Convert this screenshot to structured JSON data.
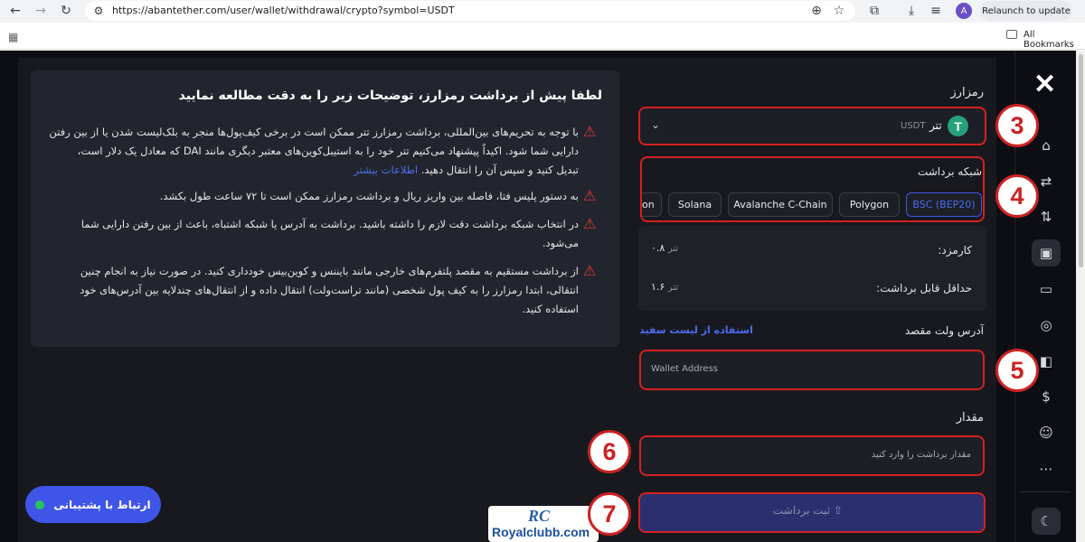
{
  "browser": {
    "url": "https://abantether.com/user/wallet/withdrawal/crypto?symbol=USDT",
    "avatar_letter": "A",
    "relaunch_label": "Relaunch to update",
    "all_bookmarks": "All Bookmarks"
  },
  "notice": {
    "title": "لطفا پیش از برداشت رمزارز، توضیحات زیر را به دقت مطالعه نمایید",
    "items": [
      {
        "lines": [
          "با توجه به تحریم‌های بین‌المللی، برداشت رمزارز تتر ممکن است در برخی کیف‌پول‌ها منجر به بلک‌لیست شدن یا از بین رفتن",
          "دارایی شما شود. اکیداً پیشنهاد می‌کنیم تتر خود را به استیبل‌کوین‌های معتبر دیگری مانند DAI که معادل یک دلار است،",
          "تبدیل کنید و سپس آن را انتقال دهید."
        ],
        "link": "اطلاعات بیشتر"
      },
      {
        "lines": [
          "به دستور پلیس فتا، فاصله بین واریز ریال و برداشت رمزارز ممکن است تا ۷۲ ساعت طول بکشد."
        ]
      },
      {
        "lines": [
          "در انتخاب شبکه برداشت دقت لازم را داشته باشید. برداشت به آدرس یا شبکه اشتباه، باعث از بین رفتن دارایی شما",
          "می‌شود."
        ]
      },
      {
        "lines": [
          "از برداشت مستقیم به مقصد پلتفرم‌های خارجی مانند بایننس و کوین‌بیس خودداری کنید. در صورت نیاز به انجام چنین",
          "انتقالی، ابتدا رمزارز را به کیف پول شخصی (مانند تراست‌ولت) انتقال داده و از انتقال‌های چندلایه بین آدرس‌های خود",
          "استفاده کنید."
        ]
      }
    ]
  },
  "form": {
    "currency_label": "رمزارز",
    "currency_name": "تتر",
    "currency_symbol": "USDT",
    "network_label": "شبکه برداشت",
    "networks": [
      "BSC (BEP20)",
      "Polygon",
      "Avalanche C-Chain",
      "Solana",
      "on"
    ],
    "fee_label": "کارمزد:",
    "fee_value": "۰.۸",
    "fee_unit": "تتر",
    "min_label": "حداقل قابل برداشت:",
    "min_value": "۱.۶",
    "min_unit": "تتر",
    "address_label": "آدرس ولت مقصد",
    "whitelist_link": "استفاده از لیست سفید",
    "address_placeholder": "Wallet Address",
    "amount_label": "مقدار",
    "amount_placeholder": "مقدار برداشت را وارد کنید",
    "submit_label": "ثبت برداشت"
  },
  "support_button": "ارتباط با پشتیبانی",
  "watermark": "Royalclubb.com",
  "watermark_logo": "RC",
  "markers": [
    "3",
    "4",
    "5",
    "6",
    "7"
  ],
  "colors": {
    "accent_red": "#d62020",
    "link_blue": "#4e6cf0",
    "support_blue": "#3f55e8",
    "usdt_green": "#26a17b"
  }
}
